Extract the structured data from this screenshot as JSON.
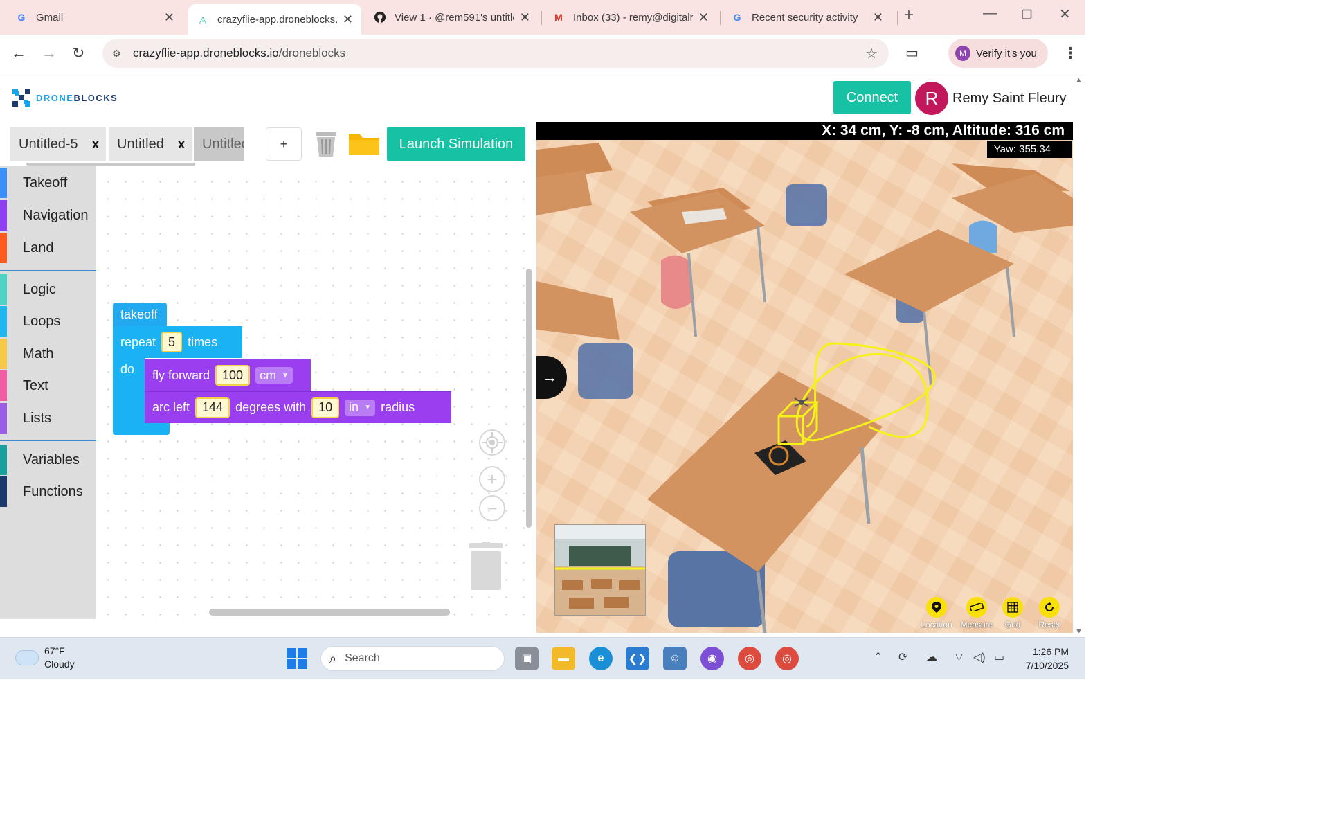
{
  "browser": {
    "tabs": [
      {
        "title": "Gmail",
        "icon": "google-g"
      },
      {
        "title": "crazyflie-app.droneblocks.",
        "icon": "droneblocks-logo"
      },
      {
        "title": "View 1 · @rem591's untitle",
        "icon": "github"
      },
      {
        "title": "Inbox (33) - remy@digitalr",
        "icon": "gmail"
      },
      {
        "title": "Recent security activity",
        "icon": "google-g"
      }
    ],
    "new_tab": "+",
    "url_host": "crazyflie-app.droneblocks.io",
    "url_path": "/droneblocks",
    "profile_button": "Verify it's you",
    "profile_initial": "M"
  },
  "app": {
    "logo_text_1": "DRONE",
    "logo_text_2": "BLOCKS",
    "connect_label": "Connect",
    "user_initial": "R",
    "user_name": "Remy Saint Fleury",
    "accent_color": "#17c1a3",
    "program_tabs": [
      {
        "name": "Untitled-5",
        "close": "x"
      },
      {
        "name": "Untitled",
        "close": "x"
      },
      {
        "name": "Untitled"
      }
    ],
    "add_tab_label": "+",
    "launch_label": "Launch Simulation"
  },
  "toolbox": {
    "categories": [
      {
        "label": "Takeoff",
        "color": "#3b8ff6"
      },
      {
        "label": "Navigation",
        "color": "#8e3ff0"
      },
      {
        "label": "Land",
        "color": "#ff5a1f"
      },
      {
        "label": "Logic",
        "color": "#4fd3c4"
      },
      {
        "label": "Loops",
        "color": "#1fb6f2"
      },
      {
        "label": "Math",
        "color": "#f7c948"
      },
      {
        "label": "Text",
        "color": "#f25ca2"
      },
      {
        "label": "Lists",
        "color": "#9b5de5"
      },
      {
        "label": "Variables",
        "color": "#1b9e9e"
      },
      {
        "label": "Functions",
        "color": "#1b3a6b"
      }
    ]
  },
  "blocks": {
    "takeoff": "takeoff",
    "repeat": "repeat",
    "repeat_count": "5",
    "times": "times",
    "do": "do",
    "fly_forward": "fly forward",
    "fly_distance": "100",
    "fly_unit": "cm",
    "arc_left": "arc left",
    "arc_degrees": "144",
    "degrees_with": "degrees with",
    "arc_radius": "10",
    "arc_unit": "in",
    "radius": "radius"
  },
  "simulator": {
    "position_readout": "X: 34 cm, Y: -8 cm, Altitude: 316 cm",
    "yaw_readout": "Yaw: 355.34",
    "expand_arrow": "→",
    "controls": [
      {
        "label": "Location",
        "icon": "location-pin"
      },
      {
        "label": "Measure",
        "icon": "ruler"
      },
      {
        "label": "Grid",
        "icon": "grid"
      },
      {
        "label": "Reset",
        "icon": "reset"
      }
    ],
    "flight_path_color": "#f5f21a"
  },
  "taskbar": {
    "temperature": "67°F",
    "condition": "Cloudy",
    "search_placeholder": "Search",
    "time": "1:26 PM",
    "date": "7/10/2025"
  }
}
